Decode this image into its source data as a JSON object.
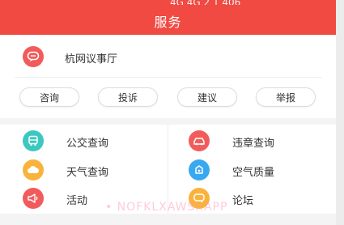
{
  "status_bar": {
    "fragment": "4G 4G  2  1  406"
  },
  "header": {
    "title": "服务",
    "color": "#f04a43"
  },
  "featured": {
    "label": "杭网议事厅",
    "icon": "chat-bubble-icon",
    "icon_color": "#f25b5b"
  },
  "actions": [
    {
      "label": "咨询"
    },
    {
      "label": "投诉"
    },
    {
      "label": "建议"
    },
    {
      "label": "举报"
    }
  ],
  "services": [
    {
      "label": "公交查询",
      "icon": "bus-icon",
      "color": "#3cc8c0"
    },
    {
      "label": "违章查询",
      "icon": "car-icon",
      "color": "#f25b5b"
    },
    {
      "label": "天气查询",
      "icon": "weather-cloud-icon",
      "color": "#f9b33c"
    },
    {
      "label": "空气质量",
      "icon": "air-quality-icon",
      "color": "#3aa8f0"
    },
    {
      "label": "活动",
      "icon": "megaphone-icon",
      "color": "#f25b5b"
    },
    {
      "label": "论坛",
      "icon": "forum-icon",
      "color": "#f9b33c"
    }
  ],
  "watermark": "• NOFKLXAWSI.APP"
}
